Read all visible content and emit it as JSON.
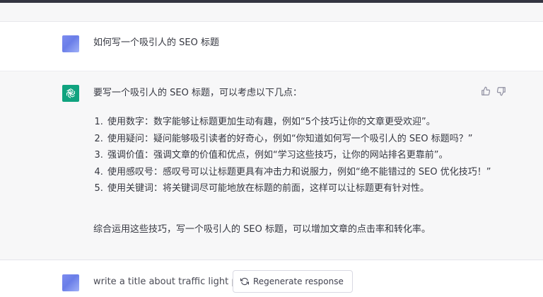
{
  "conversation": {
    "user_message_1": "如何写一个吸引人的 SEO 标题",
    "assistant": {
      "intro": "要写一个吸引人的 SEO 标题，可以考虑以下几点：",
      "tips": [
        "使用数字：数字能够让标题更加生动有趣，例如“5个技巧让你的文章更受欢迎”。",
        "使用疑问：疑问能够吸引读者的好奇心，例如“你知道如何写一个吸引人的 SEO 标题吗？”",
        "强调价值：强调文章的价值和优点，例如“学习这些技巧，让你的网站排名更靠前”。",
        "使用感叹号：感叹号可以让标题更具有冲击力和说服力，例如“绝不能错过的 SEO 优化技巧！”",
        "使用关键词：将关键词尽可能地放在标题的前面，这样可以让标题更有针对性。"
      ],
      "summary": "综合运用这些技巧，写一个吸引人的 SEO 标题，可以增加文章的点击率和转化率。"
    },
    "user_message_2": "write a title about traffic light po"
  },
  "controls": {
    "regenerate_label": "Regenerate response"
  },
  "icons": {
    "thumbs_up": "thumbs-up-icon",
    "thumbs_down": "thumbs-down-icon",
    "openai_logo": "openai-logo-icon",
    "regenerate": "refresh-icon"
  },
  "colors": {
    "assistant_avatar": "#10a37f",
    "assistant_bg": "#f7f7f8",
    "topbar": "#343541"
  }
}
